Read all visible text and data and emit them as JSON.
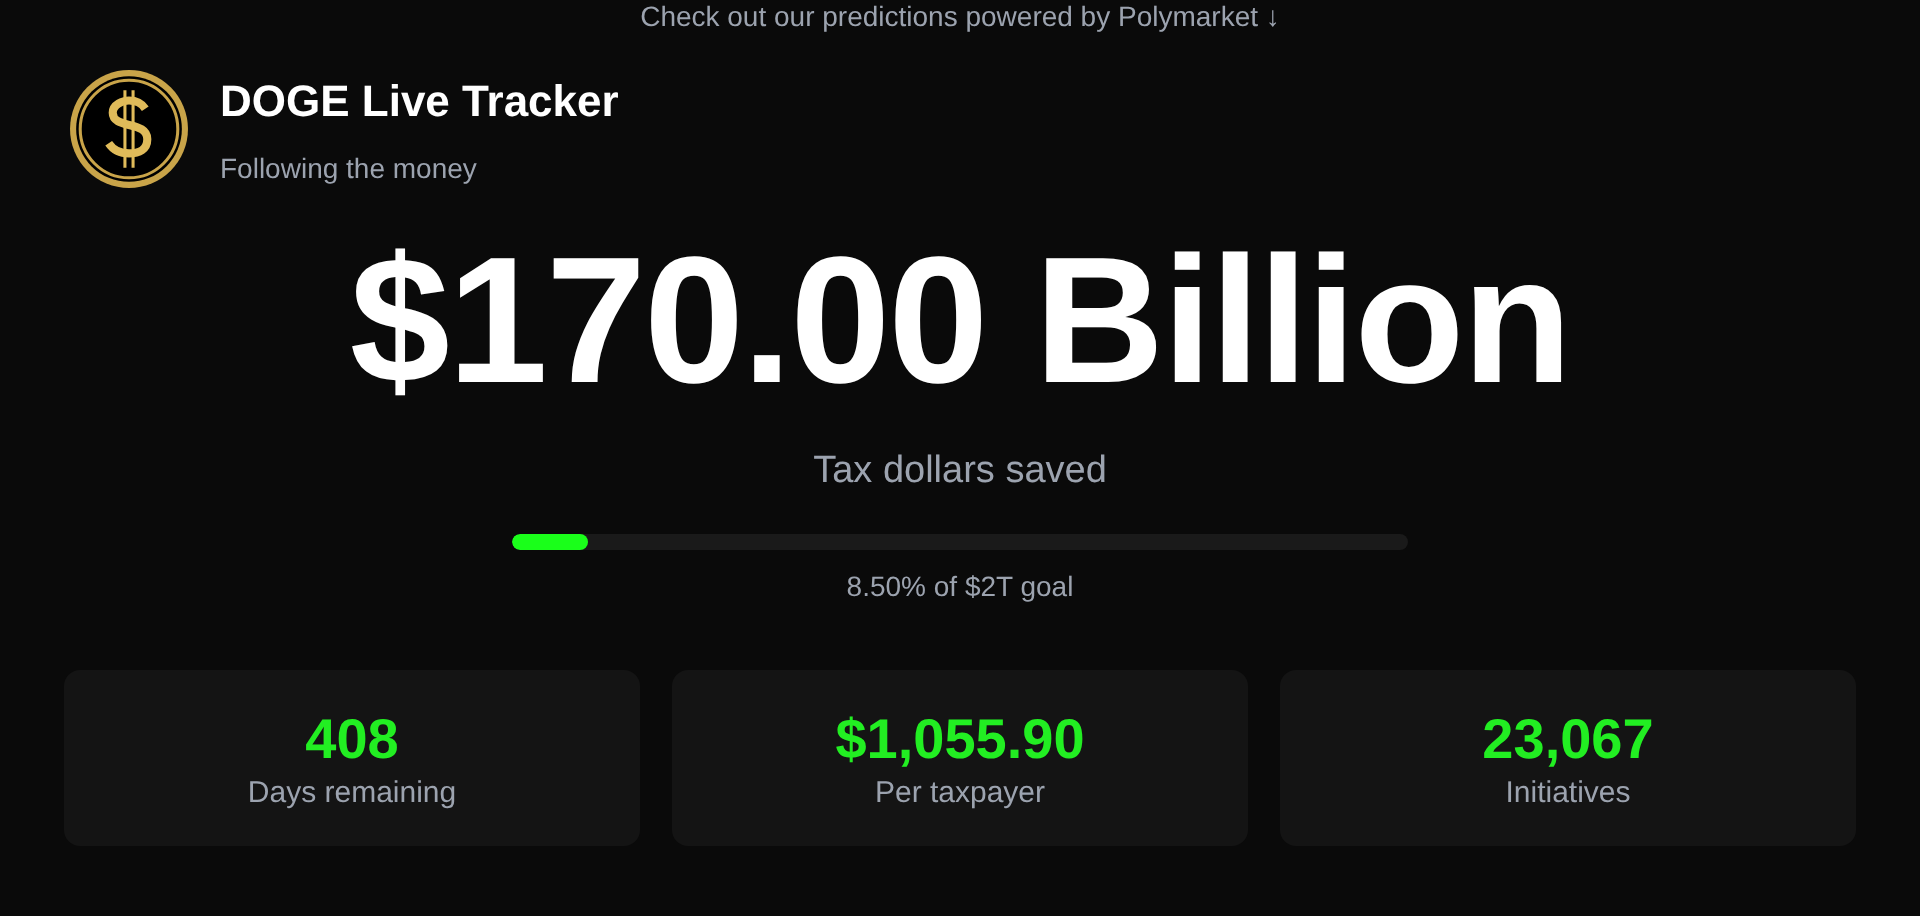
{
  "banner_link": "Check out our predictions powered by Polymarket ↓",
  "header": {
    "title": "DOGE Live Tracker",
    "subtitle": "Following the money"
  },
  "hero": {
    "amount": "$170.00 Billion",
    "caption": "Tax dollars saved",
    "progress": {
      "level": 0.085,
      "label": "8.50% of $2T goal"
    }
  },
  "stats": [
    {
      "value": "408",
      "label": "Days remaining"
    },
    {
      "value": "$1,055.90",
      "label": "Per taxpayer"
    },
    {
      "value": "23,067",
      "label": "Initiatives"
    }
  ]
}
